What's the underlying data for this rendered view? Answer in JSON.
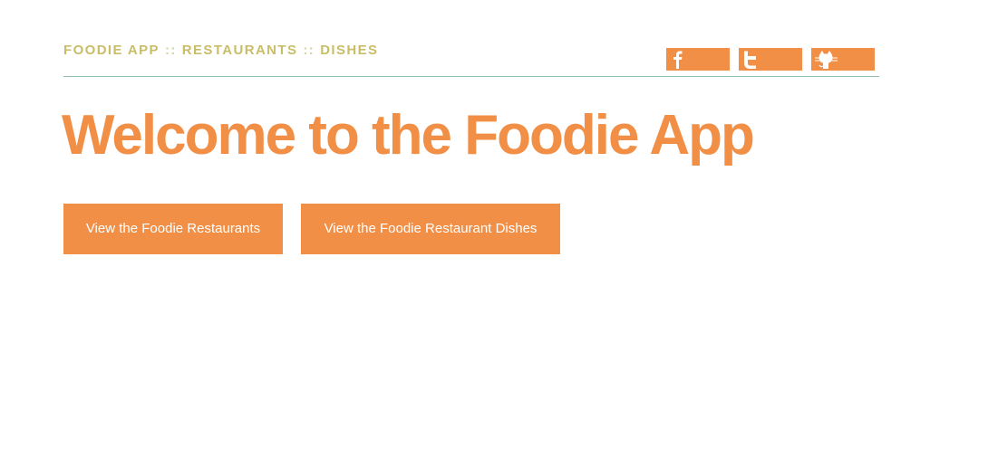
{
  "nav": {
    "home": "FOODIE APP",
    "separator": "::",
    "restaurants": "RESTAURANTS",
    "dishes": "DISHES"
  },
  "social": [
    {
      "name": "facebook",
      "icon": "facebook-icon"
    },
    {
      "name": "twitter",
      "icon": "twitter-icon"
    },
    {
      "name": "github",
      "icon": "github-icon"
    }
  ],
  "main": {
    "title": "Welcome to the Foodie App",
    "buttons": {
      "restaurants": "View the Foodie Restaurants",
      "dishes": "View the Foodie Restaurant Dishes"
    }
  },
  "colors": {
    "accent": "#f18f46",
    "nav": "#c9bd68",
    "divider": "#8fbfb4",
    "background": "#ffffff"
  }
}
